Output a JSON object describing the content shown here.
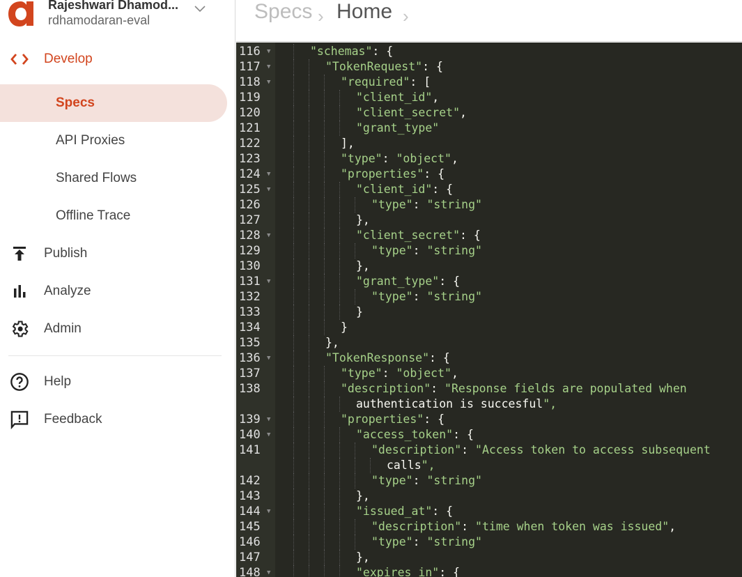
{
  "account": {
    "name": "Rajeshwari Dhamod...",
    "org": "rdhamodaran-eval"
  },
  "brand": {
    "accent": "#d2451e",
    "active_bg": "#f4e1dc"
  },
  "sidebar": {
    "develop": {
      "label": "Develop",
      "icon": "code-icon"
    },
    "sub_items": [
      {
        "label": "Specs",
        "active": true
      },
      {
        "label": "API Proxies"
      },
      {
        "label": "Shared Flows"
      },
      {
        "label": "Offline Trace"
      }
    ],
    "items": [
      {
        "label": "Publish",
        "icon": "publish-icon"
      },
      {
        "label": "Analyze",
        "icon": "bar-chart-icon"
      },
      {
        "label": "Admin",
        "icon": "gear-icon"
      }
    ],
    "footer": [
      {
        "label": "Help",
        "icon": "help-icon"
      },
      {
        "label": "Feedback",
        "icon": "feedback-icon"
      }
    ]
  },
  "breadcrumb": {
    "items": [
      "Specs",
      "Home"
    ],
    "separator": "›"
  },
  "editor": {
    "lines": [
      {
        "n": "116",
        "fold": true,
        "indent": 2,
        "text": "\"schemas\": {"
      },
      {
        "n": "117",
        "fold": true,
        "indent": 3,
        "text": "\"TokenRequest\": {"
      },
      {
        "n": "118",
        "fold": true,
        "indent": 4,
        "text": "\"required\": ["
      },
      {
        "n": "119",
        "fold": false,
        "indent": 5,
        "text": "\"client_id\","
      },
      {
        "n": "120",
        "fold": false,
        "indent": 5,
        "text": "\"client_secret\","
      },
      {
        "n": "121",
        "fold": false,
        "indent": 5,
        "text": "\"grant_type\""
      },
      {
        "n": "122",
        "fold": false,
        "indent": 4,
        "text": "],"
      },
      {
        "n": "123",
        "fold": false,
        "indent": 4,
        "text": "\"type\": \"object\","
      },
      {
        "n": "124",
        "fold": true,
        "indent": 4,
        "text": "\"properties\": {"
      },
      {
        "n": "125",
        "fold": true,
        "indent": 5,
        "text": "\"client_id\": {"
      },
      {
        "n": "126",
        "fold": false,
        "indent": 6,
        "text": "\"type\": \"string\""
      },
      {
        "n": "127",
        "fold": false,
        "indent": 5,
        "text": "},"
      },
      {
        "n": "128",
        "fold": true,
        "indent": 5,
        "text": "\"client_secret\": {"
      },
      {
        "n": "129",
        "fold": false,
        "indent": 6,
        "text": "\"type\": \"string\""
      },
      {
        "n": "130",
        "fold": false,
        "indent": 5,
        "text": "},"
      },
      {
        "n": "131",
        "fold": true,
        "indent": 5,
        "text": "\"grant_type\": {"
      },
      {
        "n": "132",
        "fold": false,
        "indent": 6,
        "text": "\"type\": \"string\""
      },
      {
        "n": "133",
        "fold": false,
        "indent": 5,
        "text": "}"
      },
      {
        "n": "134",
        "fold": false,
        "indent": 4,
        "text": "}"
      },
      {
        "n": "135",
        "fold": false,
        "indent": 3,
        "text": "},"
      },
      {
        "n": "136",
        "fold": true,
        "indent": 3,
        "text": "\"TokenResponse\": {"
      },
      {
        "n": "137",
        "fold": false,
        "indent": 4,
        "text": "\"type\": \"object\","
      },
      {
        "n": "138",
        "fold": false,
        "indent": 4,
        "text": "\"description\": \"Response fields are populated when"
      },
      {
        "n": "",
        "fold": false,
        "indent": 5,
        "text": "authentication is succesful\","
      },
      {
        "n": "139",
        "fold": true,
        "indent": 4,
        "text": "\"properties\": {"
      },
      {
        "n": "140",
        "fold": true,
        "indent": 5,
        "text": "\"access_token\": {"
      },
      {
        "n": "141",
        "fold": false,
        "indent": 6,
        "text": "\"description\": \"Access token to access subsequent"
      },
      {
        "n": "",
        "fold": false,
        "indent": 7,
        "text": "calls\","
      },
      {
        "n": "142",
        "fold": false,
        "indent": 6,
        "text": "\"type\": \"string\""
      },
      {
        "n": "143",
        "fold": false,
        "indent": 5,
        "text": "},"
      },
      {
        "n": "144",
        "fold": true,
        "indent": 5,
        "text": "\"issued_at\": {"
      },
      {
        "n": "145",
        "fold": false,
        "indent": 6,
        "text": "\"description\": \"time when token was issued\","
      },
      {
        "n": "146",
        "fold": false,
        "indent": 6,
        "text": "\"type\": \"string\""
      },
      {
        "n": "147",
        "fold": false,
        "indent": 5,
        "text": "},"
      },
      {
        "n": "148",
        "fold": true,
        "indent": 5,
        "text": "\"expires_in\": {"
      }
    ]
  }
}
